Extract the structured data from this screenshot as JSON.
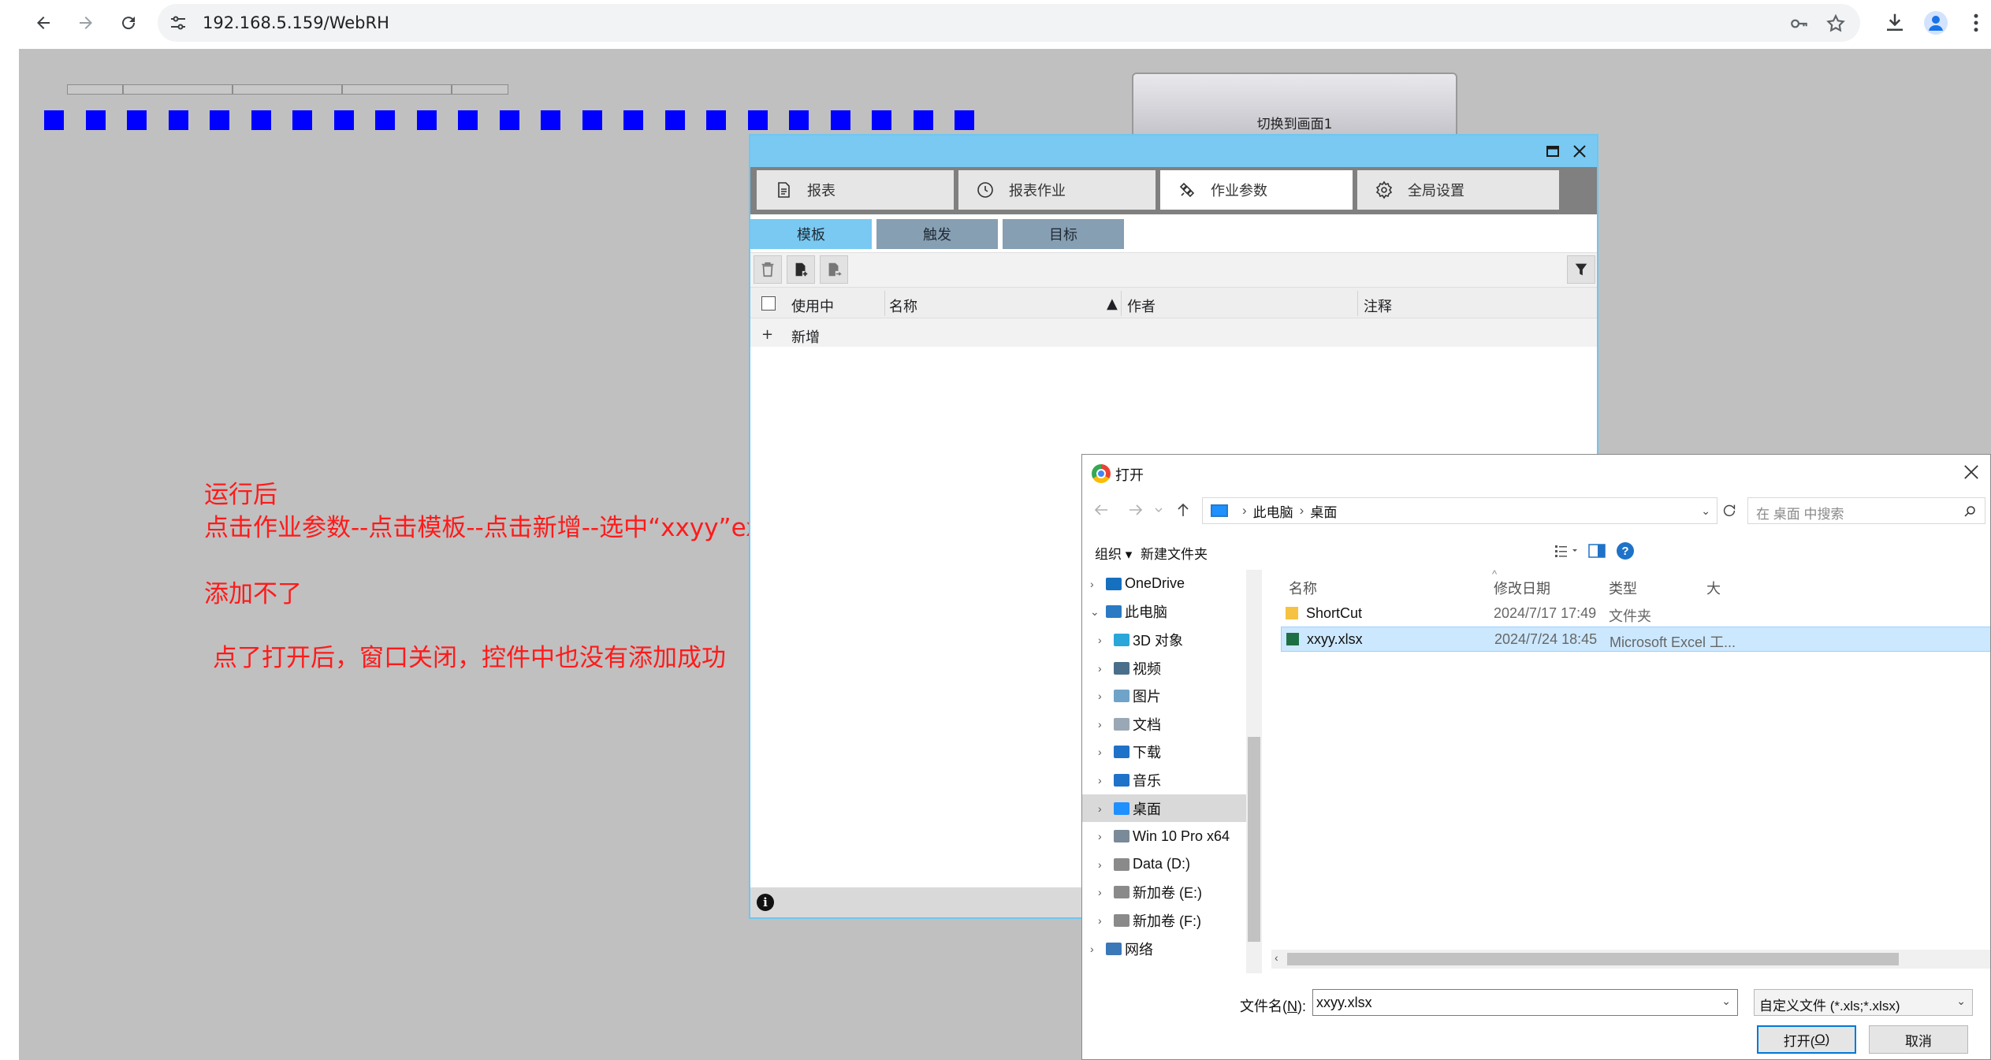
{
  "browser": {
    "url": "192.168.5.159/WebRH"
  },
  "page": {
    "switch_button": "切换到画面1",
    "notes": [
      "运行后",
      "点击作业参数--点击模板--点击新增--选中“xxyy”excel模板",
      "添加不了",
      "点了打开后，窗口关闭，控件中也没有添加成功"
    ],
    "square_count": 23,
    "square_color": "#0000ff"
  },
  "report_window": {
    "tabs": [
      {
        "label": "报表",
        "icon": "report-icon"
      },
      {
        "label": "报表作业",
        "icon": "clock-icon"
      },
      {
        "label": "作业参数",
        "icon": "satellite-icon"
      },
      {
        "label": "全局设置",
        "icon": "gear-icon"
      }
    ],
    "active_tab": "作业参数",
    "subtabs": [
      "模板",
      "触发",
      "目标"
    ],
    "active_subtab": "模板",
    "columns": [
      "使用中",
      "名称",
      "作者",
      "注释"
    ],
    "sort_indicator": "▲",
    "add_row": {
      "symbol": "+",
      "label": "新增"
    }
  },
  "open_dialog": {
    "title": "打开",
    "breadcrumb": [
      "此电脑",
      "桌面"
    ],
    "search_placeholder": "在 桌面 中搜索",
    "organize": "组织 ▾",
    "new_folder": "新建文件夹",
    "nav_items": [
      {
        "label": "OneDrive",
        "level": 0,
        "expand": "›",
        "icon_color": "#1570c0"
      },
      {
        "label": "此电脑",
        "level": 0,
        "expand": "⌄",
        "icon_color": "#2a7ac4"
      },
      {
        "label": "3D 对象",
        "level": 1,
        "expand": "›",
        "icon_color": "#2aa6d8"
      },
      {
        "label": "视频",
        "level": 1,
        "expand": "›",
        "icon_color": "#4a6f8a"
      },
      {
        "label": "图片",
        "level": 1,
        "expand": "›",
        "icon_color": "#6fa3c8"
      },
      {
        "label": "文档",
        "level": 1,
        "expand": "›",
        "icon_color": "#9aa8b5"
      },
      {
        "label": "下载",
        "level": 1,
        "expand": "›",
        "icon_color": "#1e72c8"
      },
      {
        "label": "音乐",
        "level": 1,
        "expand": "›",
        "icon_color": "#1e72c8"
      },
      {
        "label": "桌面",
        "level": 1,
        "expand": "›",
        "icon_color": "#1e90ff",
        "selected": true
      },
      {
        "label": "Win 10 Pro x64",
        "level": 1,
        "expand": "›",
        "icon_color": "#7a8a99"
      },
      {
        "label": "Data (D:)",
        "level": 1,
        "expand": "›",
        "icon_color": "#8a8a8a"
      },
      {
        "label": "新加卷 (E:)",
        "level": 1,
        "expand": "›",
        "icon_color": "#8a8a8a"
      },
      {
        "label": "新加卷 (F:)",
        "level": 1,
        "expand": "›",
        "icon_color": "#8a8a8a"
      },
      {
        "label": "网络",
        "level": 0,
        "expand": "›",
        "icon_color": "#3a78b8"
      }
    ],
    "file_columns": [
      "名称",
      "修改日期",
      "类型",
      "大"
    ],
    "files": [
      {
        "name": "ShortCut",
        "date": "2024/7/17 17:49",
        "type": "文件夹",
        "icon": "folder-icon",
        "selected": false
      },
      {
        "name": "xxyy.xlsx",
        "date": "2024/7/24 18:45",
        "type": "Microsoft Excel 工...",
        "icon": "excel-icon",
        "selected": true
      }
    ],
    "filename_label_pre": "文件名(",
    "filename_label_key": "N",
    "filename_label_post": "):",
    "filename_value": "xxyy.xlsx",
    "filetype": "自定义文件 (*.xls;*.xlsx)",
    "open_pre": "打开(",
    "open_key": "O",
    "open_post": ")",
    "cancel": "取消"
  }
}
